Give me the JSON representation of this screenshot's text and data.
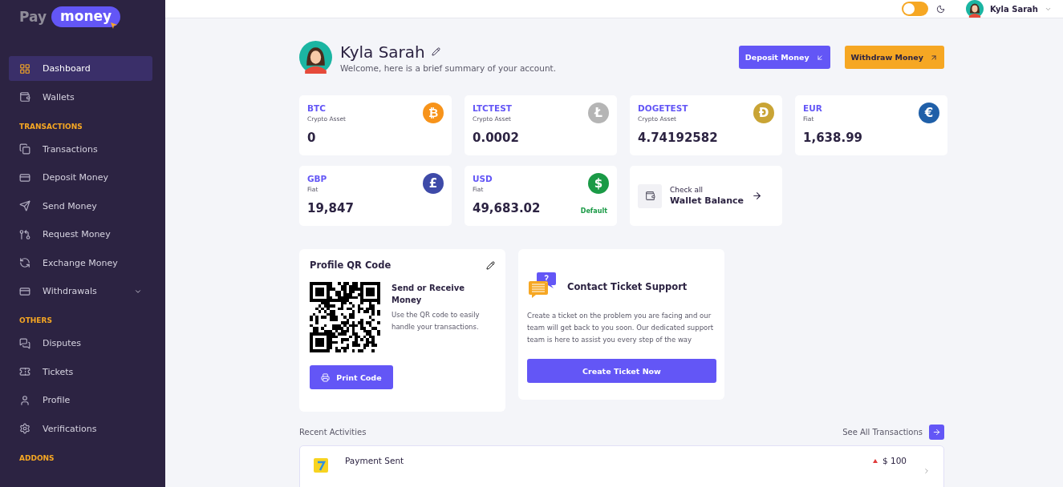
{
  "brand": {
    "first": "Pay",
    "second": "money"
  },
  "sidebar": {
    "sections": [
      {
        "items": [
          {
            "label": "Dashboard",
            "selected": true,
            "kind": "link"
          },
          {
            "label": "Wallets",
            "selected": false,
            "kind": "link"
          }
        ]
      },
      {
        "heading": "TRANSACTIONS",
        "items": [
          {
            "label": "Transactions",
            "selected": false,
            "kind": "link"
          },
          {
            "label": "Deposit Money",
            "selected": false,
            "kind": "link"
          },
          {
            "label": "Send Money",
            "selected": false,
            "kind": "link"
          },
          {
            "label": "Request Money",
            "selected": false,
            "kind": "link"
          },
          {
            "label": "Exchange Money",
            "selected": false,
            "kind": "link"
          },
          {
            "label": "Withdrawals",
            "selected": false,
            "kind": "dropdown"
          }
        ]
      },
      {
        "heading": "OTHERS",
        "items": [
          {
            "label": "Disputes",
            "selected": false,
            "kind": "link"
          },
          {
            "label": "Tickets",
            "selected": false,
            "kind": "link"
          },
          {
            "label": "Profile",
            "selected": false,
            "kind": "link"
          },
          {
            "label": "Verifications",
            "selected": false,
            "kind": "link"
          }
        ]
      },
      {
        "heading": "ADDONS"
      }
    ]
  },
  "header": {
    "theme_toggle": {
      "on": false
    },
    "user_name": "Kyla Sarah"
  },
  "profile": {
    "name": "Kyla Sarah",
    "welcome": "Welcome, here is a brief summary of your account."
  },
  "actions": [
    {
      "label": "Deposit Money",
      "kind": "deposit"
    },
    {
      "label": "Withdraw Money",
      "kind": "withdraw"
    }
  ],
  "wallets": [
    {
      "code": "BTC",
      "type": "Crypto Asset",
      "amount": "0",
      "symbol": "₿",
      "color": "#f7931a"
    },
    {
      "code": "LTCTEST",
      "type": "Crypto Asset",
      "amount": "0.0002",
      "symbol": "Ł",
      "color": "#b5b5b5"
    },
    {
      "code": "DOGETEST",
      "type": "Crypto Asset",
      "amount": "4.74192582",
      "symbol": "Ð",
      "color": "#c9a435"
    },
    {
      "code": "EUR",
      "type": "Fiat",
      "amount": "1,638.99",
      "symbol": "€",
      "color": "#1f5fa8"
    },
    {
      "code": "GBP",
      "type": "Fiat",
      "amount": "19,847",
      "symbol": "£",
      "color": "#3e4aa8"
    },
    {
      "code": "USD",
      "type": "Fiat",
      "amount": "49,683.02",
      "symbol": "$",
      "color": "#1a9a46",
      "badge": "Default"
    }
  ],
  "wallet_balance": {
    "line1": "Check all",
    "line2": "Wallet Balance"
  },
  "qr_card": {
    "title": "Profile QR Code",
    "heading": "Send or Receive Money",
    "text": "Use the QR code to easily handle your transactions.",
    "button": "Print Code"
  },
  "support_card": {
    "title": "Contact Ticket Support",
    "text": "Create a ticket on the problem you are facing and our team will get back to you soon. Our dedicated support team is here to assist you every step of the way",
    "button": "Create Ticket Now"
  },
  "recent": {
    "title": "Recent Activities",
    "link": "See All Transactions",
    "rows": [
      {
        "title": "Payment Sent",
        "amount": "$ 100",
        "up": true
      }
    ]
  }
}
